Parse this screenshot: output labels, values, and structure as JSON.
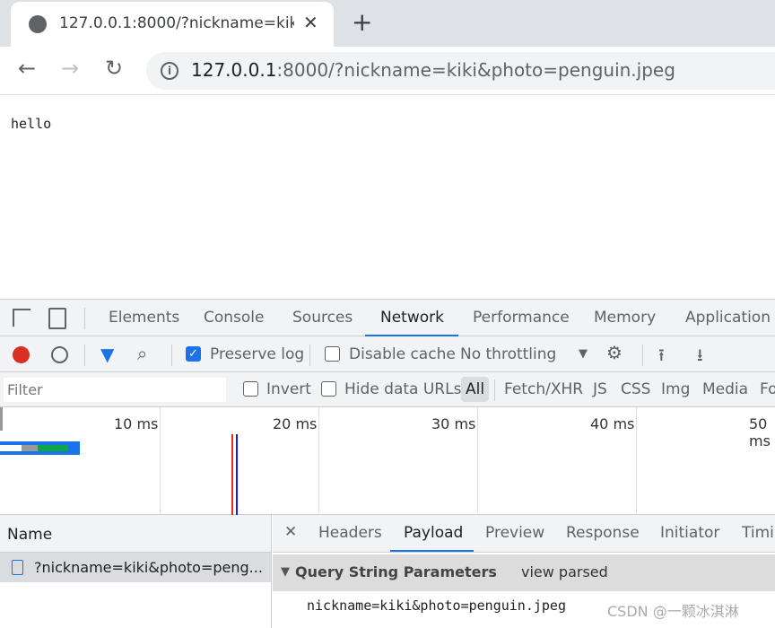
{
  "browser": {
    "tab_title": "127.0.0.1:8000/?nickname=kiki&photo=penguin.jpeg",
    "url_host": "127.0.0.1",
    "url_rest": ":8000/?nickname=kiki&photo=penguin.jpeg",
    "icons": {
      "back": "←",
      "forward": "→",
      "reload": "↻",
      "close": "✕",
      "new_tab": "+",
      "info": "i"
    }
  },
  "page": {
    "text": "hello"
  },
  "devtools": {
    "tabs": [
      "Elements",
      "Console",
      "Sources",
      "Network",
      "Performance",
      "Memory",
      "Application"
    ],
    "active_tab": "Network",
    "toolbar": {
      "preserve_log": "Preserve log",
      "preserve_log_checked": true,
      "disable_cache": "Disable cache",
      "disable_cache_checked": false,
      "throttling": "No throttling"
    },
    "filter": {
      "placeholder": "Filter",
      "invert": "Invert",
      "hide_data_urls": "Hide data URLs",
      "types": [
        "All",
        "Fetch/XHR",
        "JS",
        "CSS",
        "Img",
        "Media",
        "Fo"
      ],
      "active_type": "All"
    },
    "timeline": {
      "ticks": [
        "10 ms",
        "20 ms",
        "30 ms",
        "40 ms",
        "50 ms"
      ]
    },
    "requests": {
      "header": "Name",
      "items": [
        {
          "name": "?nickname=kiki&photo=peng..."
        }
      ]
    },
    "details": {
      "tabs": [
        "Headers",
        "Payload",
        "Preview",
        "Response",
        "Initiator",
        "Timi"
      ],
      "active_tab": "Payload",
      "section_title": "Query String Parameters",
      "view_toggle": "view parsed",
      "query_string": "nickname=kiki&photo=penguin.jpeg"
    }
  },
  "watermark": "CSDN @一颗冰淇淋",
  "colors": {
    "accent": "#1a73e8",
    "record": "#d93025"
  }
}
